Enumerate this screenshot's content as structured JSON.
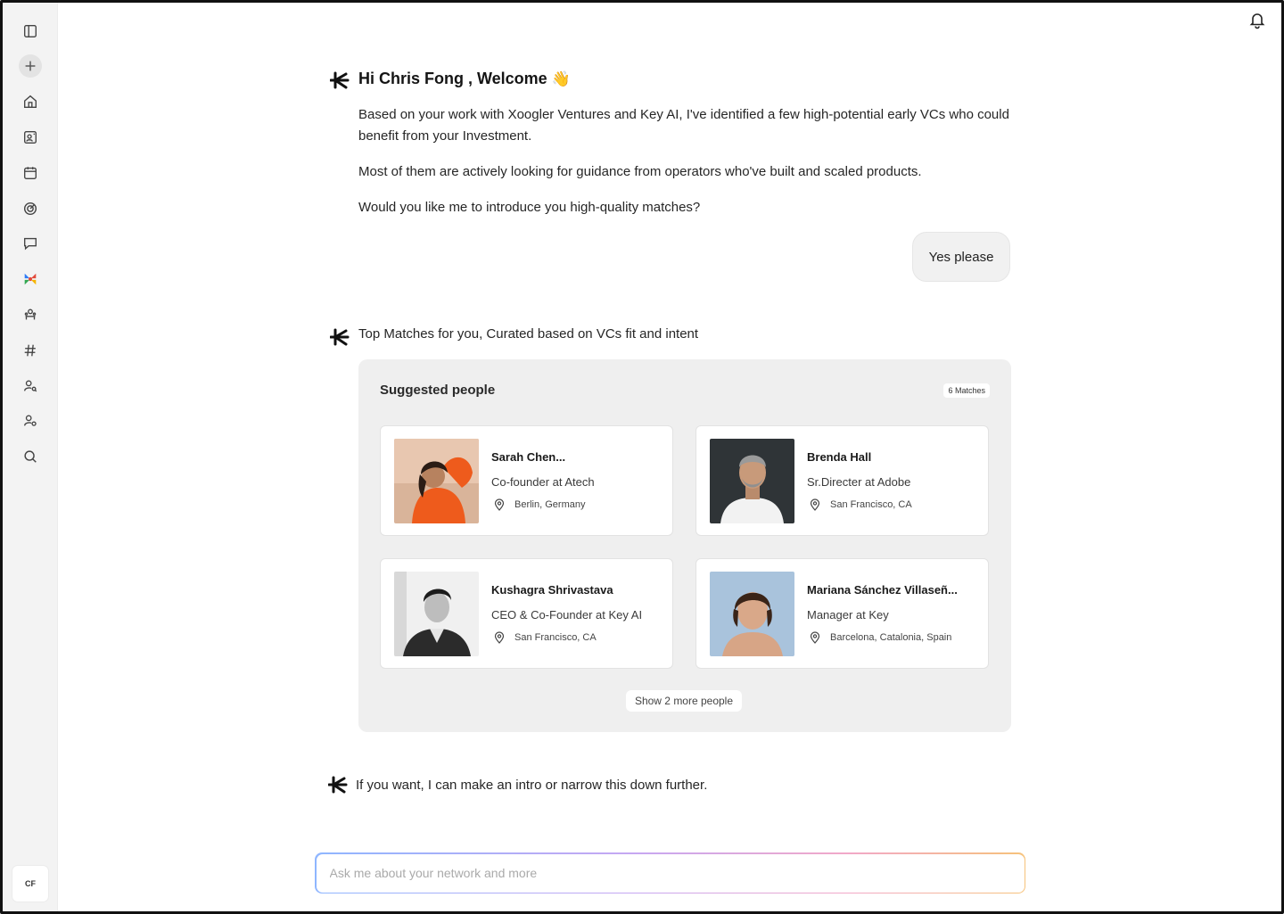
{
  "greeting": {
    "text": "Hi Chris Fong , Welcome",
    "emoji": "👋"
  },
  "messages": {
    "intro_1": "Based on your work with Xoogler Ventures and Key AI, I've identified a few high-potential early VCs who could benefit from your Investment.",
    "intro_2": "Most of them are actively looking for guidance from operators who've built and scaled products.",
    "intro_3": "Would you like me to introduce you high-quality matches?",
    "user_reply": "Yes please",
    "matches_intro": "Top Matches for you, Curated based on VCs fit and intent",
    "closing": "If you want, I can make an intro or narrow this down further."
  },
  "suggested": {
    "title": "Suggested people",
    "badge": "6 Matches",
    "show_more": "Show 2 more people",
    "people": [
      {
        "name": "Sarah Chen...",
        "role": "Co-founder at Atech",
        "location": "Berlin, Germany"
      },
      {
        "name": "Brenda Hall",
        "role": "Sr.Directer at Adobe",
        "location": "San Francisco, CA"
      },
      {
        "name": "Kushagra Shrivastava",
        "role": "CEO & Co-Founder at Key AI",
        "location": "San Francisco, CA"
      },
      {
        "name": "Mariana Sánchez Villaseñ...",
        "role": "Manager at Key",
        "location": "Barcelona, Catalonia, Spain"
      }
    ]
  },
  "input": {
    "placeholder": "Ask me about your network and more"
  },
  "user": {
    "initials": "CF"
  },
  "icons": {
    "sidebar": [
      "sidebar-toggle-icon",
      "plus-icon",
      "home-icon",
      "contacts-icon",
      "calendar-icon",
      "analytics-icon",
      "chat-icon",
      "apps-icon",
      "group-icon",
      "hashtag-icon",
      "person-search-icon",
      "person-settings-icon",
      "search-icon"
    ],
    "top_right": "bell-icon",
    "assistant": "asterisk-logo-icon",
    "location": "location-pin-icon"
  }
}
